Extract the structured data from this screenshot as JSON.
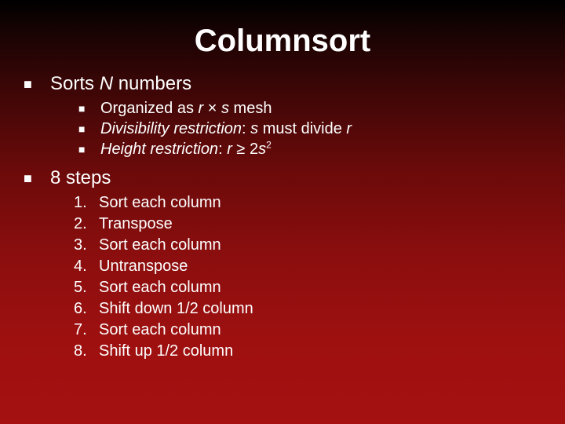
{
  "title": "Columnsort",
  "top1": {
    "pre": "Sorts ",
    "var": "N",
    "post": " numbers"
  },
  "sub": [
    {
      "pre": "Organized as ",
      "r": "r",
      "mid": " × ",
      "s": "s",
      "post": " mesh"
    },
    {
      "label": "Divisibility restriction",
      "sep": ": ",
      "s": "s",
      "mid": " must divide ",
      "r": "r"
    },
    {
      "label": "Height restriction",
      "sep": ": ",
      "r": "r",
      "rel": " ≥ 2",
      "s": "s",
      "exp": "2"
    }
  ],
  "top2": "8 steps",
  "steps": [
    "Sort each column",
    "Transpose",
    "Sort each column",
    "Untranspose",
    "Sort each column",
    "Shift down 1/2 column",
    "Sort each column",
    "Shift up 1/2 column"
  ],
  "nums": [
    "1.",
    "2.",
    "3.",
    "4.",
    "5.",
    "6.",
    "7.",
    "8."
  ]
}
